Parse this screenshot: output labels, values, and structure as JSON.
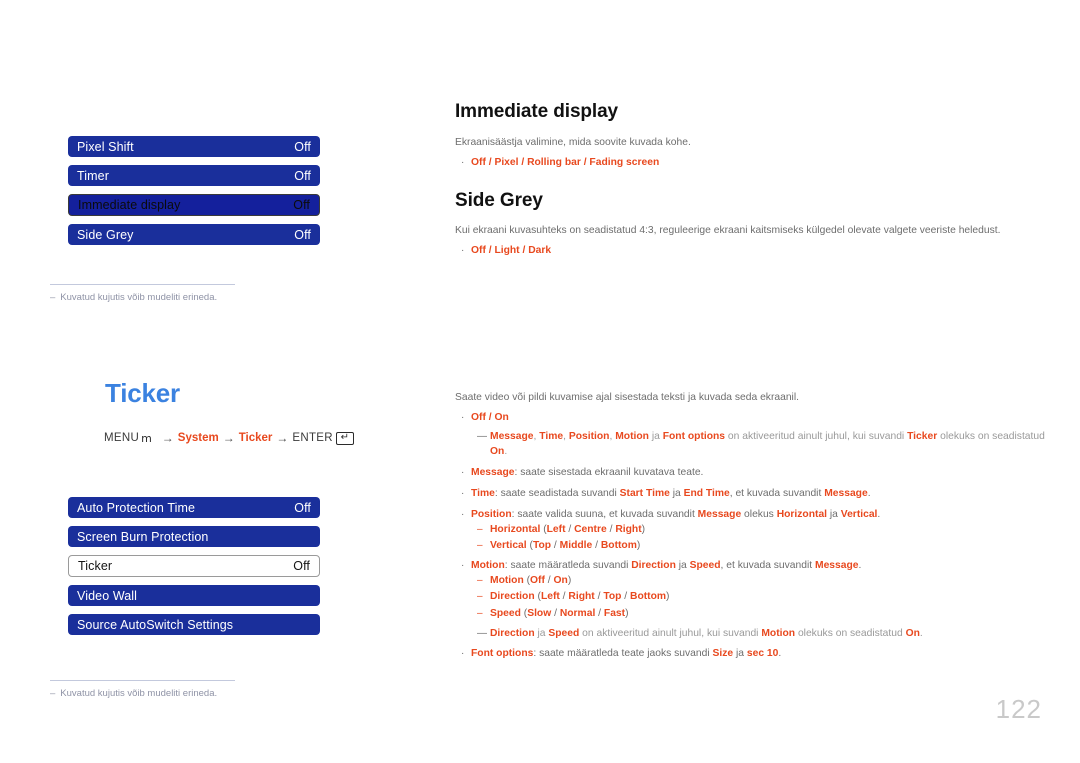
{
  "page": {
    "number": "122",
    "accent_blue": "#3b82e0",
    "osd_blue": "#1a2f9b",
    "accent_red": "#e8491f"
  },
  "left": {
    "osd_top": {
      "rows": [
        {
          "label": "Pixel Shift",
          "value": "Off",
          "state": "normal"
        },
        {
          "label": "Timer",
          "value": "Off",
          "state": "normal"
        },
        {
          "label": "Immediate display",
          "value": "Off",
          "state": "selected"
        },
        {
          "label": "Side Grey",
          "value": "Off",
          "state": "normal"
        }
      ]
    },
    "note_top": {
      "dash": "–",
      "text": "Kuvatud kujutis võib mudeliti erineda."
    },
    "ticker_heading": "Ticker",
    "menu_path": {
      "menu_label": "MENU",
      "menu_glyph": "m",
      "arrow": "→",
      "step1": "System",
      "step2": "Ticker",
      "enter_label": "ENTER",
      "enter_glyph": "↵"
    },
    "osd_bottom": {
      "rows": [
        {
          "label": "Auto Protection Time",
          "value": "Off",
          "state": "normal"
        },
        {
          "label": "Screen Burn Protection",
          "value": "",
          "state": "normal"
        },
        {
          "label": "Ticker",
          "value": "Off",
          "state": "white"
        },
        {
          "label": "Video Wall",
          "value": "",
          "state": "normal"
        },
        {
          "label": "Source AutoSwitch Settings",
          "value": "",
          "state": "normal"
        }
      ]
    },
    "note_bottom": {
      "dash": "–",
      "text": "Kuvatud kujutis võib mudeliti erineda."
    }
  },
  "right": {
    "immediate_display": {
      "title": "Immediate display",
      "desc": "Ekraanisäästja valimine, mida soovite kuvada kohe.",
      "bullet_dot": "·",
      "options": "Off / Pixel / Rolling bar / Fading screen"
    },
    "side_grey": {
      "title": "Side Grey",
      "desc": "Kui ekraani kuvasuhteks on seadistatud 4:3, reguleerige ekraani kaitsmiseks külgedel olevate valgete veeriste heledust.",
      "bullet_dot": "·",
      "options": "Off / Light / Dark"
    },
    "ticker": {
      "desc": "Saate video või pildi kuvamise ajal sisestada teksti ja kuvada seda ekraanil.",
      "bullet_dot": "·",
      "sub_dash": "–",
      "note_mark": "—",
      "b1_options": "Off / On",
      "n1_p1": "Message",
      "n1_s1": ", ",
      "n1_p2": "Time",
      "n1_s2": ", ",
      "n1_p3": "Position",
      "n1_s3": ", ",
      "n1_p4": "Motion",
      "n1_s4": " ja ",
      "n1_p5": "Font options",
      "n1_s5": " on aktiveeritud ainult juhul, kui suvandi ",
      "n1_p6": "Ticker",
      "n1_s6": " olekuks on seadistatud ",
      "n1_p7": "On",
      "n1_s7": ".",
      "b2_key": "Message",
      "b2_text": ": saate sisestada ekraanil kuvatava teate.",
      "b3_key": "Time",
      "b3_t1": ": saate seadistada suvandi ",
      "b3_k2": "Start Time",
      "b3_t2": " ja ",
      "b3_k3": "End Time",
      "b3_t3": ", et kuvada suvandit ",
      "b3_k4": "Message",
      "b3_t4": ".",
      "b4_key": "Position",
      "b4_t1": ": saate valida suuna, et kuvada suvandit ",
      "b4_k2": "Message",
      "b4_t2": " olekus ",
      "b4_k3": "Horizontal",
      "b4_t3": " ja ",
      "b4_k4": "Vertical",
      "b4_t4": ".",
      "s1_key": "Horizontal",
      "s1_open": " (",
      "s1_v1": "Left",
      "s1_sep1": " / ",
      "s1_v2": "Centre",
      "s1_sep2": " / ",
      "s1_v3": "Right",
      "s1_close": ")",
      "s2_key": "Vertical",
      "s2_open": " (",
      "s2_v1": "Top",
      "s2_sep1": " / ",
      "s2_v2": "Middle",
      "s2_sep2": " / ",
      "s2_v3": "Bottom",
      "s2_close": ")",
      "b5_key": "Motion",
      "b5_t1": ": saate määratleda suvandi ",
      "b5_k2": "Direction",
      "b5_t2": " ja ",
      "b5_k3": "Speed",
      "b5_t3": ", et kuvada suvandit ",
      "b5_k4": "Message",
      "b5_t4": ".",
      "s3_key": "Motion",
      "s3_open": " (",
      "s3_v1": "Off",
      "s3_sep1": " / ",
      "s3_v2": "On",
      "s3_close": ")",
      "s4_key": "Direction",
      "s4_open": " (",
      "s4_v1": "Left",
      "s4_sep1": " / ",
      "s4_v2": "Right",
      "s4_sep2": " / ",
      "s4_v3": "Top",
      "s4_sep3": " / ",
      "s4_v4": "Bottom",
      "s4_close": ")",
      "s5_key": "Speed",
      "s5_open": " (",
      "s5_v1": "Slow",
      "s5_sep1": " / ",
      "s5_v2": "Normal",
      "s5_sep2": " / ",
      "s5_v3": "Fast",
      "s5_close": ")",
      "n2_p1": "Direction",
      "n2_s1": " ja ",
      "n2_p2": "Speed",
      "n2_s2": " on aktiveeritud ainult juhul, kui suvandi ",
      "n2_p3": "Motion",
      "n2_s3": " olekuks on seadistatud ",
      "n2_p4": "On",
      "n2_s4": ".",
      "b6_key": "Font options",
      "b6_t1": ": saate määratleda teate jaoks suvandi ",
      "b6_k2": "Size",
      "b6_t2": " ja ",
      "b6_k3": "sec 10",
      "b6_t3": "."
    }
  }
}
